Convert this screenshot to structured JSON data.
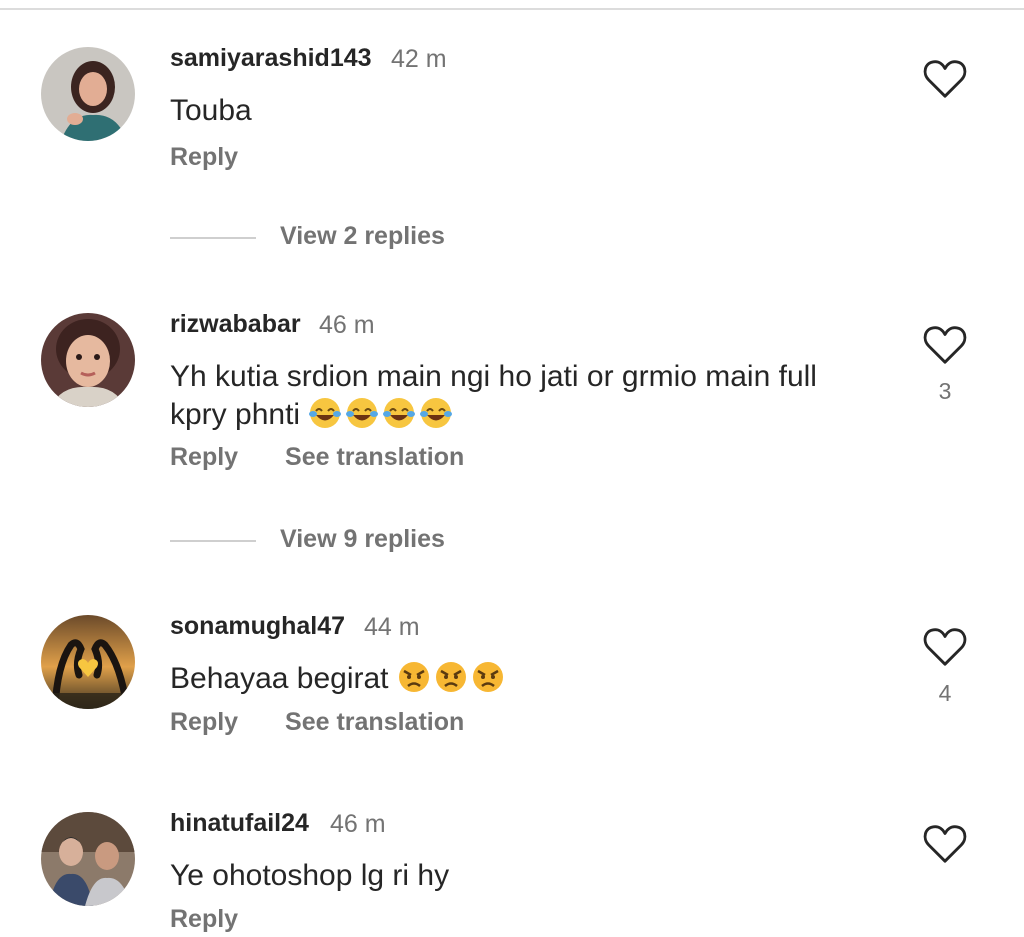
{
  "comments": [
    {
      "username": "samiyarashid143",
      "time": "42 m",
      "text": "Touba",
      "reply": "Reply",
      "see_translation": "",
      "likes": "",
      "replies": "View 2 replies"
    },
    {
      "username": "rizwababar",
      "time": "46 m",
      "text": "Yh kutia srdion main ngi ho jati or grmio main full kpry phnti",
      "reply": "Reply",
      "see_translation": "See translation",
      "likes": "3",
      "replies": "View 9 replies"
    },
    {
      "username": "sonamughal47",
      "time": "44 m",
      "text": "Behayaa begirat",
      "reply": "Reply",
      "see_translation": "See translation",
      "likes": "4",
      "replies": ""
    },
    {
      "username": "hinatufail24",
      "time": "46 m",
      "text": "Ye ohotoshop lg ri hy",
      "reply": "Reply",
      "see_translation": "",
      "likes": "",
      "replies": ""
    }
  ],
  "icons": {
    "heart": "heart-outline-icon",
    "laugh_emoji": "face-with-tears-of-joy-emoji",
    "angry_emoji": "angry-face-emoji"
  },
  "colors": {
    "text": "#262626",
    "secondary": "#737373",
    "divider": "#dcdcdc"
  }
}
